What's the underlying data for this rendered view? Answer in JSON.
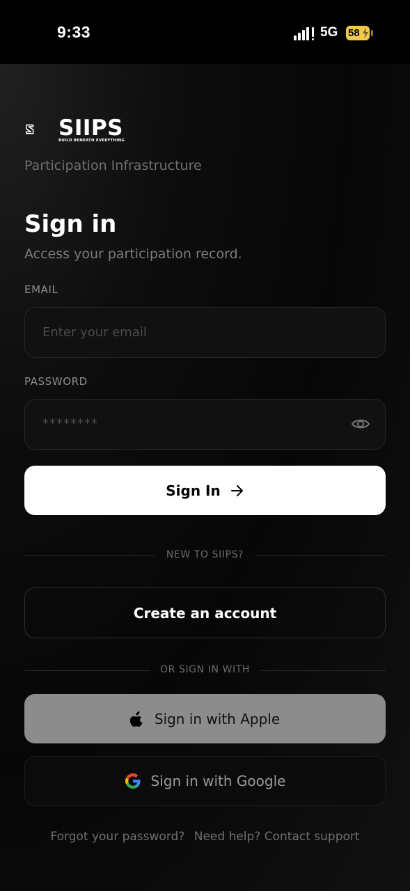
{
  "status_bar": {
    "time": "9:33",
    "network": "5G",
    "battery": "58"
  },
  "brand": {
    "name": "SIIPS",
    "tagline": "BUILD BENEATH EVERYTHING",
    "subtitle": "Participation Infrastructure"
  },
  "signin": {
    "title": "Sign in",
    "caption": "Access your participation record.",
    "email_label": "EMAIL",
    "email_placeholder": "Enter your email",
    "password_label": "PASSWORD",
    "password_value": "********",
    "submit_label": "Sign In"
  },
  "register": {
    "divider": "NEW TO SIIPS?",
    "create_label": "Create an account"
  },
  "social": {
    "divider": "OR SIGN IN WITH",
    "apple_label": "Sign in with Apple",
    "google_label": "Sign in with Google"
  },
  "footer": {
    "forgot": "Forgot your password?",
    "help": "Need help? Contact support"
  },
  "colors": {
    "background": "#000000",
    "battery": "#f2c94c",
    "primary_button": "#ffffff",
    "apple_button": "#8c8c8c"
  }
}
